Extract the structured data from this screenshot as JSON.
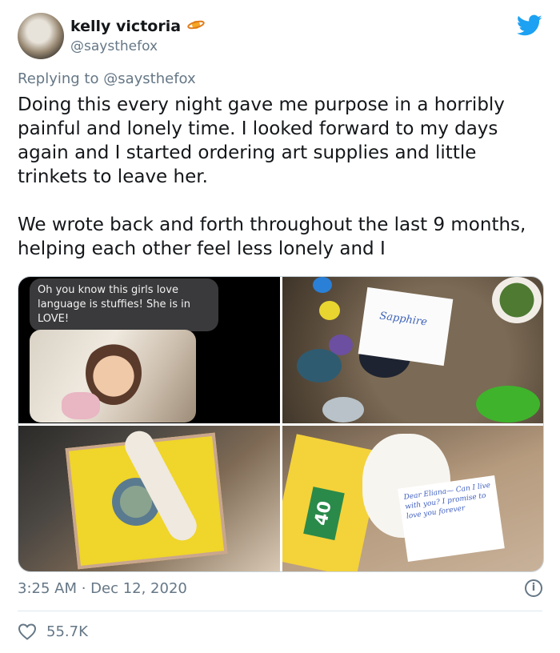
{
  "author": {
    "display_name": "kelly victoria",
    "handle": "@saysthefox",
    "badge_icon": "planet-emoji-icon"
  },
  "reply": {
    "prefix": "Replying to",
    "mention": "@saysthefox"
  },
  "tweet": {
    "text": "Doing this every night gave me purpose in a horribly painful and lonely time. I looked forward to my days again and I started ordering art supplies and little trinkets to leave her.\n\nWe wrote back and forth throughout the last 9 months, helping each other feel less lonely and I",
    "timestamp": "3:25 AM · Dec 12, 2020",
    "likes": "55.7K"
  },
  "media": {
    "image1_message": "Oh you know this girls love language is stuffies! She is in LOVE!",
    "image2_card_text": "Sapphire",
    "image4_crayon_label": "40",
    "image4_letter_text": "Dear Eliana— Can I live with you? I promise to love you forever"
  },
  "colors": {
    "twitter_blue": "#1da1f2",
    "secondary_text": "#657786",
    "primary_text": "#14171a"
  }
}
